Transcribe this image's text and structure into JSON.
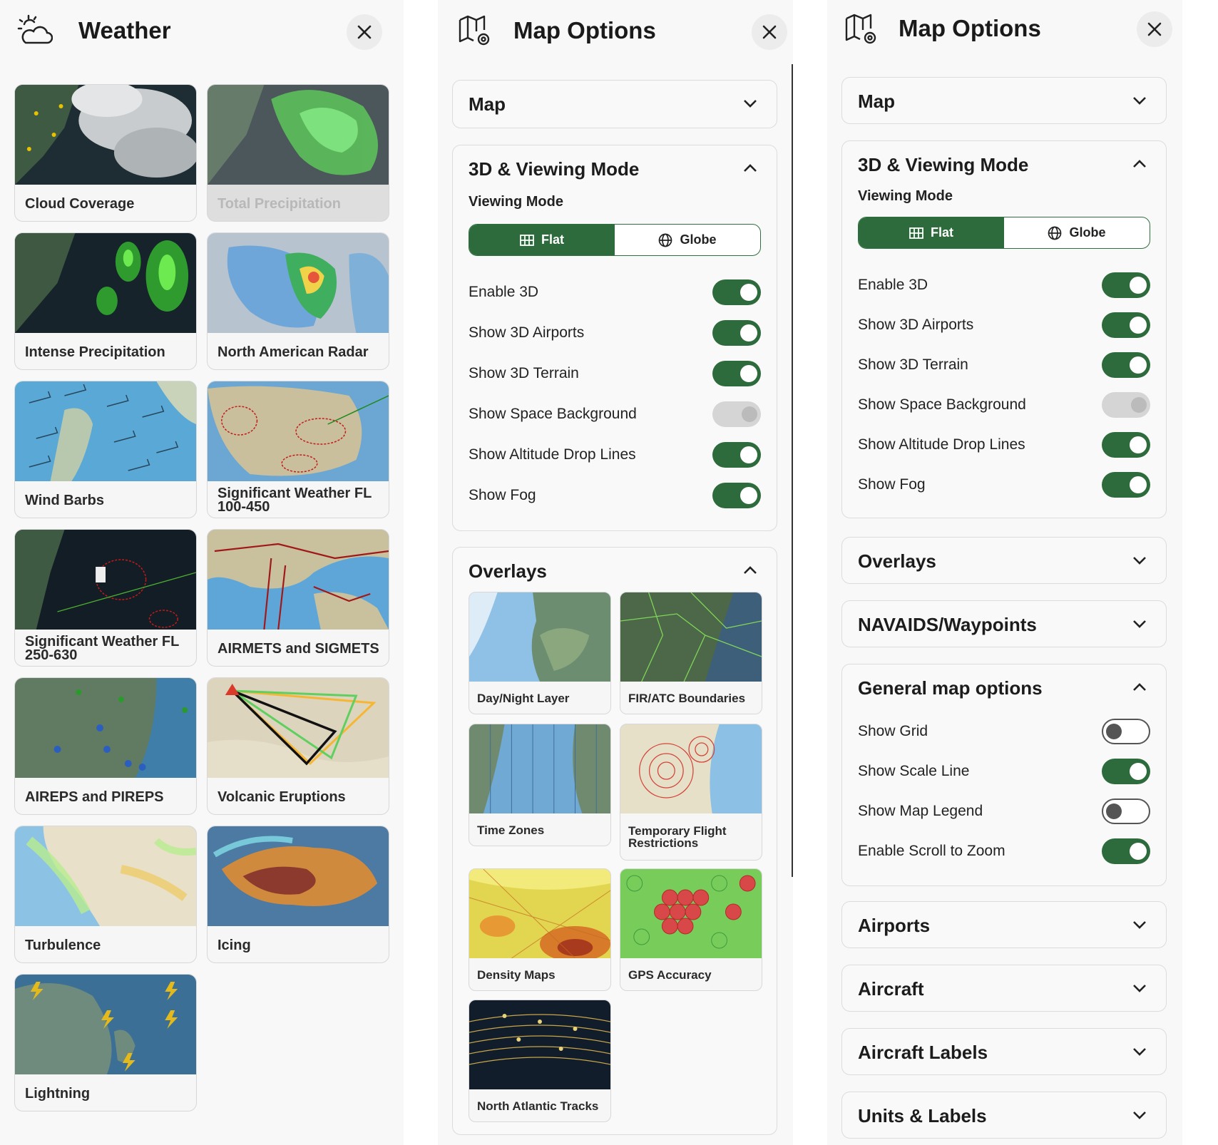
{
  "weather_panel": {
    "title": "Weather",
    "header_icon": "sun-cloud-icon",
    "close_icon": "close-icon",
    "cards": [
      {
        "label": "Cloud Coverage",
        "disabled": false
      },
      {
        "label": "Total Precipitation",
        "disabled": true
      },
      {
        "label": "Intense Precipitation",
        "disabled": false
      },
      {
        "label": "North American Radar",
        "disabled": false
      },
      {
        "label": "Wind Barbs",
        "disabled": false
      },
      {
        "label": "Significant Weather FL 100-450",
        "disabled": false
      },
      {
        "label": "Significant Weather FL 250-630",
        "disabled": false
      },
      {
        "label": "AIRMETS and SIGMETS",
        "disabled": false
      },
      {
        "label": "AIREPS and PIREPS",
        "disabled": false
      },
      {
        "label": "Volcanic Eruptions",
        "disabled": false
      },
      {
        "label": "Turbulence",
        "disabled": false
      },
      {
        "label": "Icing",
        "disabled": false
      },
      {
        "label": "Lightning",
        "disabled": false
      }
    ]
  },
  "map_options_a": {
    "title": "Map Options",
    "header_icon": "map-settings-icon",
    "close_icon": "close-icon",
    "sections": {
      "map": {
        "label": "Map",
        "expanded": false
      },
      "viewing": {
        "label": "3D & Viewing Mode",
        "expanded": true,
        "sub_label": "Viewing Mode",
        "modes": {
          "flat": "Flat",
          "globe": "Globe",
          "selected": "Flat"
        },
        "toggles": [
          {
            "label": "Enable 3D",
            "state": "on"
          },
          {
            "label": "Show 3D Airports",
            "state": "on"
          },
          {
            "label": "Show 3D Terrain",
            "state": "on"
          },
          {
            "label": "Show Space Background",
            "state": "disabled"
          },
          {
            "label": "Show Altitude Drop Lines",
            "state": "on"
          },
          {
            "label": "Show Fog",
            "state": "on"
          }
        ]
      },
      "overlays": {
        "label": "Overlays",
        "expanded": true,
        "cards": [
          {
            "label": "Day/Night Layer"
          },
          {
            "label": "FIR/ATC Boundaries"
          },
          {
            "label": "Time Zones"
          },
          {
            "label": "Temporary Flight Restrictions"
          },
          {
            "label": "Density Maps"
          },
          {
            "label": "GPS Accuracy"
          },
          {
            "label": "North Atlantic Tracks"
          }
        ]
      }
    }
  },
  "map_options_b": {
    "title": "Map Options",
    "header_icon": "map-settings-icon",
    "close_icon": "close-icon",
    "sections": {
      "map": {
        "label": "Map",
        "expanded": false
      },
      "viewing": {
        "label": "3D & Viewing Mode",
        "expanded": true,
        "sub_label": "Viewing Mode",
        "modes": {
          "flat": "Flat",
          "globe": "Globe",
          "selected": "Flat"
        },
        "toggles": [
          {
            "label": "Enable 3D",
            "state": "on"
          },
          {
            "label": "Show 3D Airports",
            "state": "on"
          },
          {
            "label": "Show 3D Terrain",
            "state": "on"
          },
          {
            "label": "Show Space Background",
            "state": "disabled"
          },
          {
            "label": "Show Altitude Drop Lines",
            "state": "on"
          },
          {
            "label": "Show Fog",
            "state": "on"
          }
        ]
      },
      "overlays": {
        "label": "Overlays",
        "expanded": false
      },
      "navaids": {
        "label": "NAVAIDS/Waypoints",
        "expanded": false
      },
      "general": {
        "label": "General map options",
        "expanded": true,
        "toggles": [
          {
            "label": "Show Grid",
            "state": "off"
          },
          {
            "label": "Show Scale Line",
            "state": "on"
          },
          {
            "label": "Show Map Legend",
            "state": "off"
          },
          {
            "label": "Enable Scroll to Zoom",
            "state": "on"
          }
        ]
      },
      "airports": {
        "label": "Airports",
        "expanded": false
      },
      "aircraft": {
        "label": "Aircraft",
        "expanded": false
      },
      "aircraft_labels": {
        "label": "Aircraft Labels",
        "expanded": false
      },
      "units_labels": {
        "label": "Units & Labels",
        "expanded": false
      }
    }
  },
  "colors": {
    "accent_green": "#2e6b3c",
    "toggle_off_knob": "#555555",
    "card_border": "#d8d8d8"
  }
}
